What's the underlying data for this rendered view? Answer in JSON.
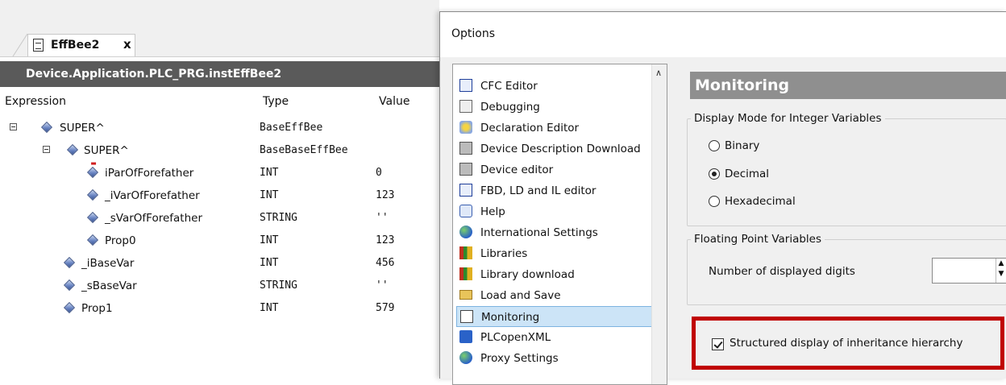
{
  "watch": {
    "tab_label": "EffBee2",
    "close_glyph": "x",
    "path": "Device.Application.PLC_PRG.instEffBee2",
    "columns": {
      "expression": "Expression",
      "type": "Type",
      "value": "Value"
    },
    "rows": [
      {
        "name": "SUPER^",
        "type": "BaseEffBee",
        "value": ""
      },
      {
        "name": "SUPER^",
        "type": "BaseBaseEffBee",
        "value": ""
      },
      {
        "name": "iParOfForefather",
        "type": "INT",
        "value": "0"
      },
      {
        "name": "_iVarOfForefather",
        "type": "INT",
        "value": "123"
      },
      {
        "name": "_sVarOfForefather",
        "type": "STRING",
        "value": "''"
      },
      {
        "name": "Prop0",
        "type": "INT",
        "value": "123"
      },
      {
        "name": "_iBaseVar",
        "type": "INT",
        "value": "456"
      },
      {
        "name": "_sBaseVar",
        "type": "STRING",
        "value": "''"
      },
      {
        "name": "Prop1",
        "type": "INT",
        "value": "579"
      }
    ]
  },
  "dialog": {
    "title": "Options",
    "categories": [
      {
        "label": "CFC Editor",
        "icon": "cfc-icon"
      },
      {
        "label": "Debugging",
        "icon": "debug-icon"
      },
      {
        "label": "Declaration Editor",
        "icon": "declaration-icon"
      },
      {
        "label": "Device Description Download",
        "icon": "device-download-icon"
      },
      {
        "label": "Device editor",
        "icon": "device-editor-icon"
      },
      {
        "label": "FBD, LD and IL editor",
        "icon": "fbd-icon"
      },
      {
        "label": "Help",
        "icon": "help-icon"
      },
      {
        "label": "International Settings",
        "icon": "globe-icon"
      },
      {
        "label": "Libraries",
        "icon": "library-icon"
      },
      {
        "label": "Library download",
        "icon": "library-download-icon"
      },
      {
        "label": "Load and Save",
        "icon": "folder-icon"
      },
      {
        "label": "Monitoring",
        "icon": "monitoring-icon"
      },
      {
        "label": "PLCopenXML",
        "icon": "xml-icon"
      },
      {
        "label": "Proxy Settings",
        "icon": "proxy-icon"
      }
    ],
    "selected_category": "Monitoring",
    "pane_title": "Monitoring",
    "integer_group": {
      "label": "Display Mode for Integer Variables",
      "options": [
        "Binary",
        "Decimal",
        "Hexadecimal"
      ],
      "selected": "Decimal"
    },
    "float_group": {
      "label": "Floating Point Variables",
      "digits_label": "Number of displayed digits",
      "digits_value": ""
    },
    "structured_display": {
      "label": "Structured display of inheritance hierarchy",
      "checked": true
    },
    "colors": {
      "highlight": "#c00000",
      "selection": "#cce4f7",
      "path_bar": "#5a5a5a",
      "pane_title": "#8f8f8f"
    }
  }
}
